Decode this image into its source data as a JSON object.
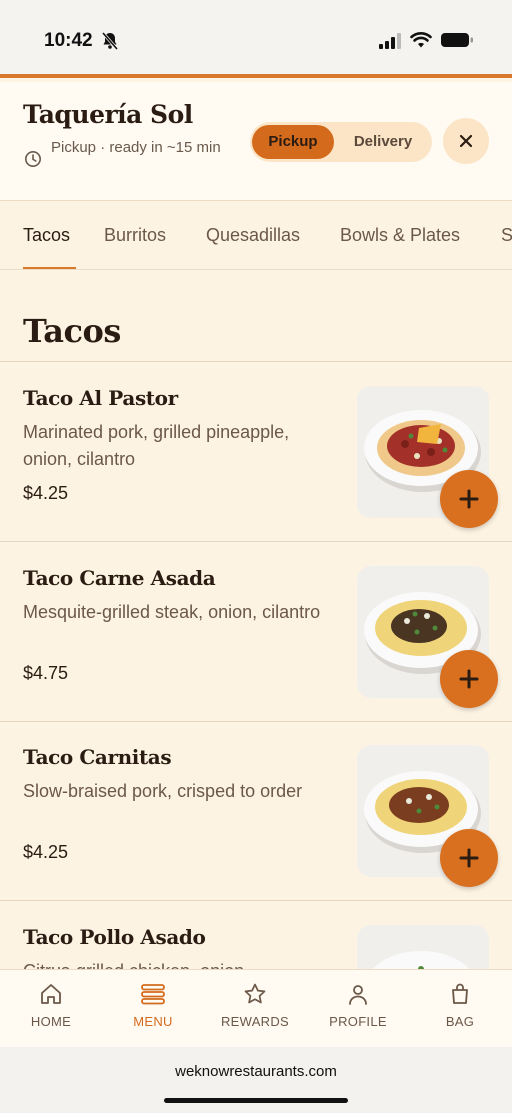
{
  "status_bar": {
    "time": "10:42",
    "icons": [
      "bell-slash-icon",
      "cellular-signal-icon",
      "wifi-icon",
      "battery-icon"
    ]
  },
  "header": {
    "store_name": "Taquería Sol",
    "pickup_info": "Pickup · ready in ~15 min",
    "toggle": {
      "pickup": "Pickup",
      "delivery": "Delivery",
      "selected": "Pickup"
    },
    "close_icon": "close-icon"
  },
  "tabs": [
    {
      "label": "Tacos",
      "active": true
    },
    {
      "label": "Burritos",
      "active": false
    },
    {
      "label": "Quesadillas",
      "active": false
    },
    {
      "label": "Bowls & Plates",
      "active": false
    },
    {
      "label": "S",
      "active": false
    }
  ],
  "section_title": "Tacos",
  "items": [
    {
      "name": "Taco Al Pastor",
      "description": "Marinated pork, grilled pineapple, onion, cilantro",
      "price": "$4.25"
    },
    {
      "name": "Taco Carne Asada",
      "description": "Mesquite-grilled steak, onion, cilantro",
      "price": "$4.75"
    },
    {
      "name": "Taco Carnitas",
      "description": "Slow-braised pork, crisped to order",
      "price": "$4.25"
    },
    {
      "name": "Taco Pollo Asado",
      "description": "Citrus-grilled chicken, onion",
      "price": ""
    }
  ],
  "bottom_nav": [
    {
      "label": "HOME",
      "icon": "home-icon",
      "active": false
    },
    {
      "label": "MENU",
      "icon": "menu-icon",
      "active": true
    },
    {
      "label": "REWARDS",
      "icon": "star-icon",
      "active": false
    },
    {
      "label": "PROFILE",
      "icon": "profile-icon",
      "active": false
    },
    {
      "label": "BAG",
      "icon": "bag-icon",
      "active": false
    }
  ],
  "url": "weknowrestaurants.com",
  "colors": {
    "accent": "#d8782d",
    "background": "#fdf3e3",
    "text": "#2a1c12"
  }
}
